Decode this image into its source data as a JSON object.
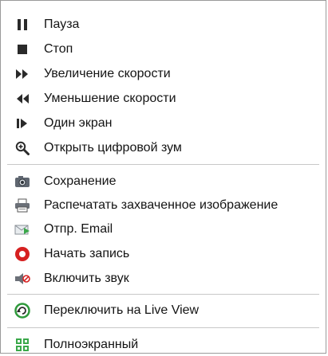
{
  "menu": {
    "items": [
      {
        "label": "Пауза",
        "icon": "pause-icon"
      },
      {
        "label": "Стоп",
        "icon": "stop-icon"
      },
      {
        "label": "Увеличение скорости",
        "icon": "fast-forward-icon"
      },
      {
        "label": "Уменьшение скорости",
        "icon": "rewind-icon"
      },
      {
        "label": "Один экран",
        "icon": "single-frame-icon"
      },
      {
        "label": "Открыть цифровой зум",
        "icon": "zoom-icon"
      },
      {
        "label": "Сохранение",
        "icon": "camera-icon"
      },
      {
        "label": "Распечатать захваченное изображение",
        "icon": "printer-icon"
      },
      {
        "label": "Отпр. Email",
        "icon": "email-icon"
      },
      {
        "label": "Начать запись",
        "icon": "record-icon"
      },
      {
        "label": "Включить звук",
        "icon": "mute-speaker-icon"
      },
      {
        "label": "Переключить на Live View",
        "icon": "live-view-icon"
      },
      {
        "label": "Полноэкранный",
        "icon": "fullscreen-icon"
      }
    ]
  },
  "colors": {
    "record": "#d62020",
    "icon_dark": "#2a2a2a",
    "green": "#3aa84a"
  }
}
